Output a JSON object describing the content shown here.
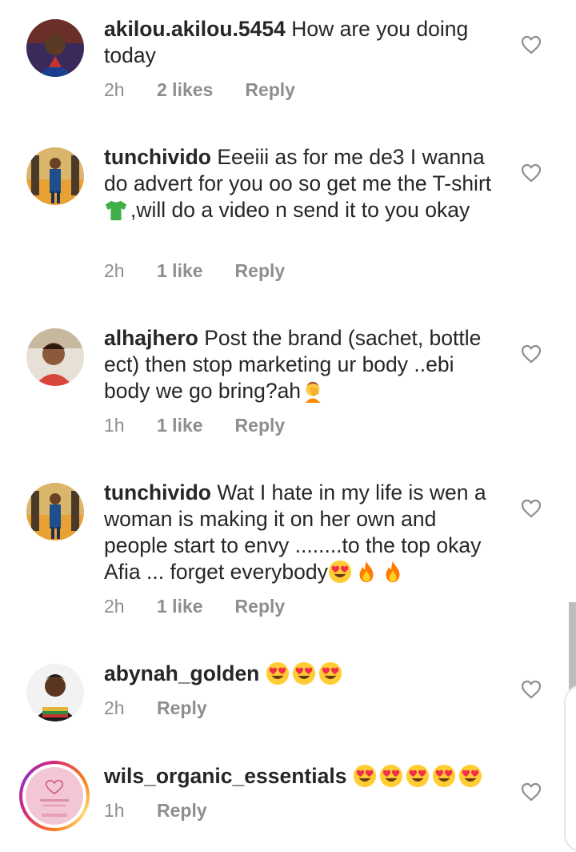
{
  "comments": [
    {
      "username": "akilou.akilou.5454",
      "body": "How are you doing today",
      "time": "2h",
      "likes": "2 likes",
      "reply": "Reply"
    },
    {
      "username": "tunchivido",
      "body_pre": "Eeeiii as for me de3 I wanna do advert for you oo so get me the T-shirt",
      "body_post": ",will do a video n send it to you okay",
      "time": "2h",
      "likes": "1 like",
      "reply": "Reply"
    },
    {
      "username": "alhajhero",
      "body_pre": "Post the brand (sachet, bottle ect) then stop marketing ur body ..ebi body we go bring?ah",
      "time": "1h",
      "likes": "1 like",
      "reply": "Reply"
    },
    {
      "username": "tunchivido",
      "body_pre": "Wat I hate in my life is wen a woman is making it on her own and people start to envy ........to the top okay Afia ... forget everybody",
      "time": "2h",
      "likes": "1 like",
      "reply": "Reply"
    },
    {
      "username": "abynah_golden",
      "time": "2h",
      "reply": "Reply"
    },
    {
      "username": "wils_organic_essentials",
      "time": "1h",
      "reply": "Reply"
    }
  ],
  "colors": {
    "text": "#262626",
    "meta": "#8e8e8e",
    "heart_outline": "#8e8e8e"
  },
  "icons": {
    "like": "heart-outline-icon",
    "tshirt": "tshirt-emoji",
    "facepalm": "facepalm-emoji",
    "heart_eyes": "heart-eyes-emoji",
    "fire": "fire-emoji"
  }
}
